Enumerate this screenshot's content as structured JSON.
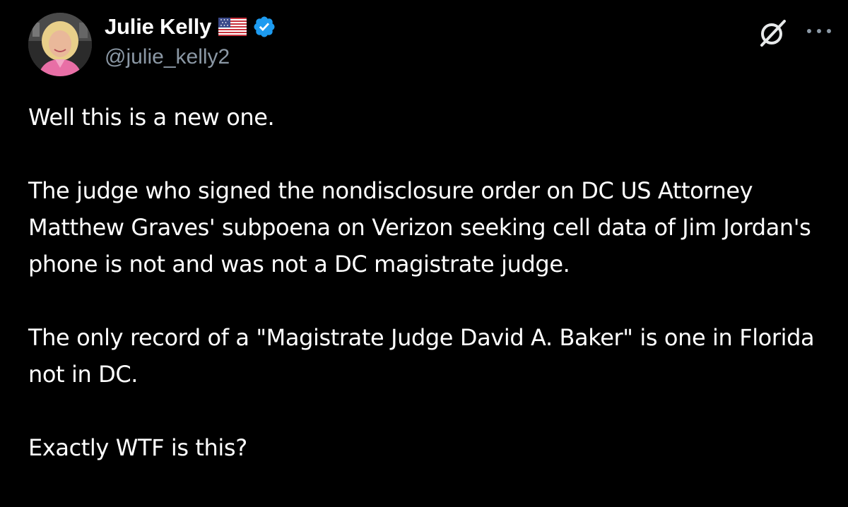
{
  "author": {
    "display_name": "Julie Kelly",
    "handle": "@julie_kelly2",
    "flag_icon": "us-flag-icon",
    "verified": true,
    "verified_color": "#1d9bf0"
  },
  "actions": {
    "grok_icon": "grok-icon",
    "more_icon": "more-dots-icon"
  },
  "tweet": {
    "paragraphs": [
      "Well this is a new one.",
      "The judge who signed the nondisclosure order on DC US Attorney Matthew Graves' subpoena on Verizon seeking cell data of Jim Jordan's phone is not and was not a DC magistrate judge.",
      "The only record of a \"Magistrate Judge David A. Baker\" is one in Florida not in DC.",
      "Exactly WTF is this?"
    ]
  },
  "colors": {
    "background": "#000000",
    "text": "#ffffff",
    "secondary_text": "#8b98a5"
  }
}
